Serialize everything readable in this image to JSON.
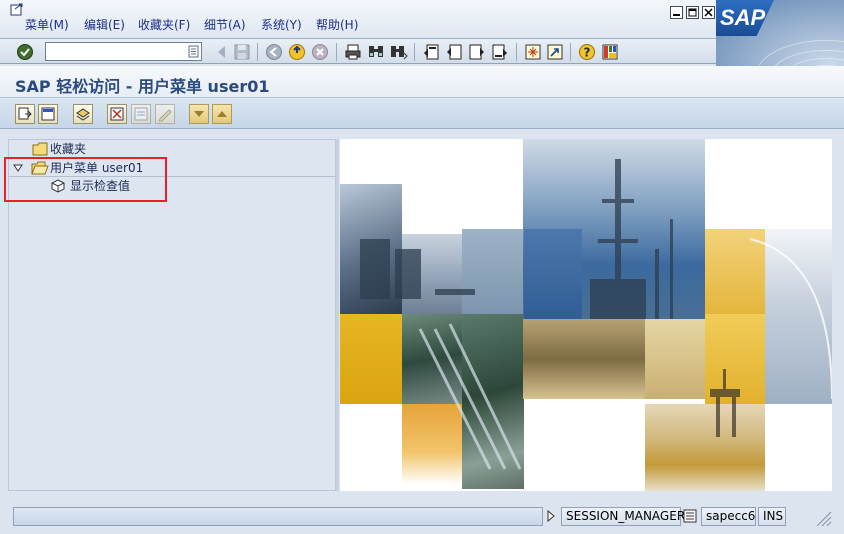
{
  "menubar": {
    "items": [
      {
        "label": "菜单(M)"
      },
      {
        "label": "编辑(E)"
      },
      {
        "label": "收藏夹(F)"
      },
      {
        "label": "细节(A)"
      },
      {
        "label": "系统(Y)"
      },
      {
        "label": "帮助(H)"
      }
    ],
    "window_buttons": [
      "minimize-icon",
      "maximize-icon",
      "close-icon"
    ]
  },
  "brand": {
    "logo_text": "SAP",
    "color": "#1a4c95"
  },
  "command_field": {
    "value": "",
    "placeholder": ""
  },
  "title": "SAP 轻松访问 - 用户菜单 user01",
  "tree": {
    "favorites_label": "收藏夹",
    "user_menu_label": "用户菜单 user01",
    "user_menu_expanded": true,
    "task_label": "显示检查值"
  },
  "status": {
    "message": "",
    "session": "SESSION_MANAGER",
    "server": "sapecc6",
    "mode": "INS"
  },
  "colors": {
    "accent": "#2a4a7e",
    "highlight": "#e8202a",
    "menu_text": "#1c2f86"
  }
}
